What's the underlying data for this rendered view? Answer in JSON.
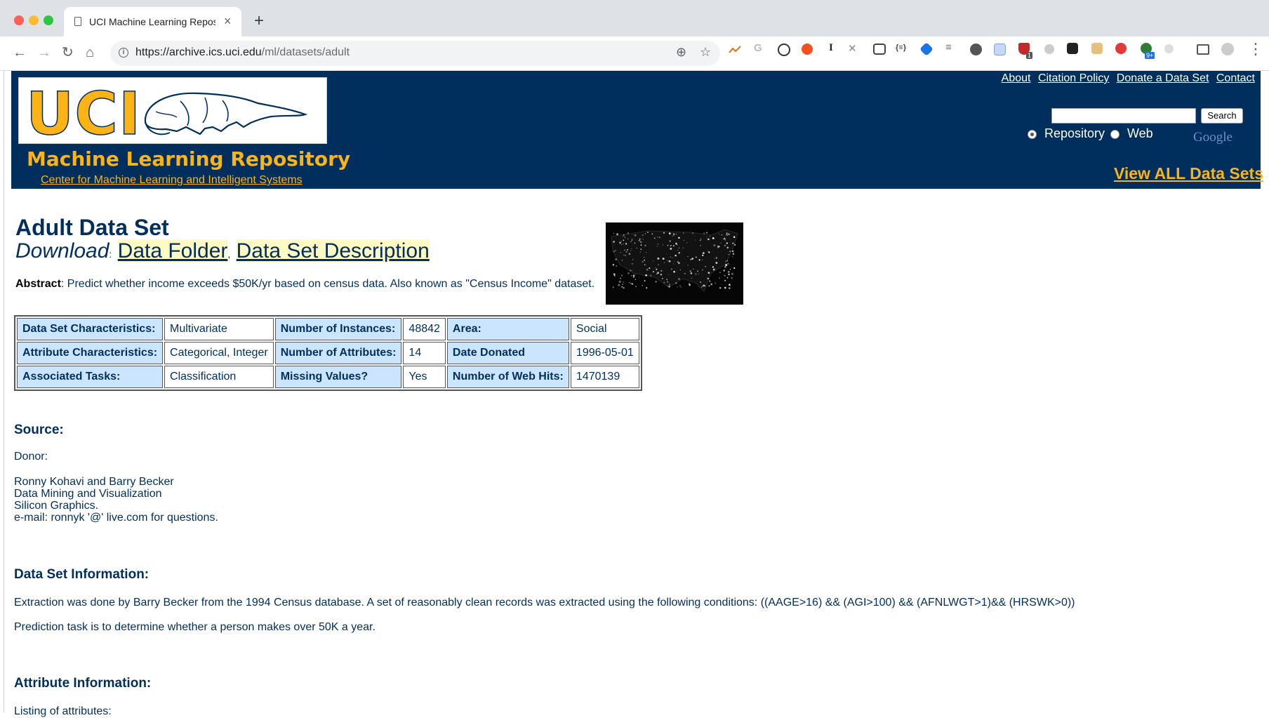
{
  "browser": {
    "tab_title": "UCI Machine Learning Repositc",
    "url_host": "https://archive.ics.uci.edu",
    "url_path": "/ml/datasets/adult",
    "ext_badge_1": "1",
    "ext_badge_2": "9+"
  },
  "header": {
    "logo_text": "UCI",
    "repo_title": "Machine Learning Repository",
    "repo_subtitle": "Center for Machine Learning and Intelligent Systems",
    "links": [
      "About",
      "Citation Policy",
      "Donate a Data Set",
      "Contact"
    ],
    "search_button": "Search",
    "radio_repository": "Repository",
    "radio_web": "Web",
    "google_label": "Google",
    "view_all": "View ALL Data Sets"
  },
  "dataset": {
    "title": "Adult Data Set",
    "download_label": "Download",
    "download_sep1": ":",
    "link_data_folder": "Data Folder",
    "download_sep2": ",",
    "link_description": "Data Set Description",
    "abstract_label": "Abstract",
    "abstract_text": ": Predict whether income exceeds $50K/yr based on census data. Also known as \"Census Income\" dataset."
  },
  "characteristics": [
    [
      {
        "k": "Data Set Characteristics:"
      },
      {
        "v": "Multivariate"
      },
      {
        "k": "Number of Instances:"
      },
      {
        "v": "48842"
      },
      {
        "k": "Area:"
      },
      {
        "v": "Social"
      }
    ],
    [
      {
        "k": "Attribute Characteristics:"
      },
      {
        "v": "Categorical, Integer"
      },
      {
        "k": "Number of Attributes:"
      },
      {
        "v": "14"
      },
      {
        "k": "Date Donated"
      },
      {
        "v": "1996-05-01"
      }
    ],
    [
      {
        "k": "Associated Tasks:"
      },
      {
        "v": "Classification"
      },
      {
        "k": "Missing Values?"
      },
      {
        "v": "Yes"
      },
      {
        "k": "Number of Web Hits:"
      },
      {
        "v": "1470139"
      }
    ]
  ],
  "source": {
    "heading": "Source:",
    "donor_label": "Donor:",
    "lines": [
      "Ronny Kohavi and Barry Becker",
      "Data Mining and Visualization",
      "Silicon Graphics.",
      "e-mail: ronnyk '@' live.com for questions."
    ]
  },
  "info": {
    "heading": "Data Set Information:",
    "p1": "Extraction was done by Barry Becker from the 1994 Census database. A set of reasonably clean records was extracted using the following conditions: ((AAGE>16) && (AGI>100) && (AFNLWGT>1)&& (HRSWK>0))",
    "p2": "Prediction task is to determine whether a person makes over 50K a year."
  },
  "attributes": {
    "heading": "Attribute Information:",
    "first_line": "Listing of attributes:"
  }
}
